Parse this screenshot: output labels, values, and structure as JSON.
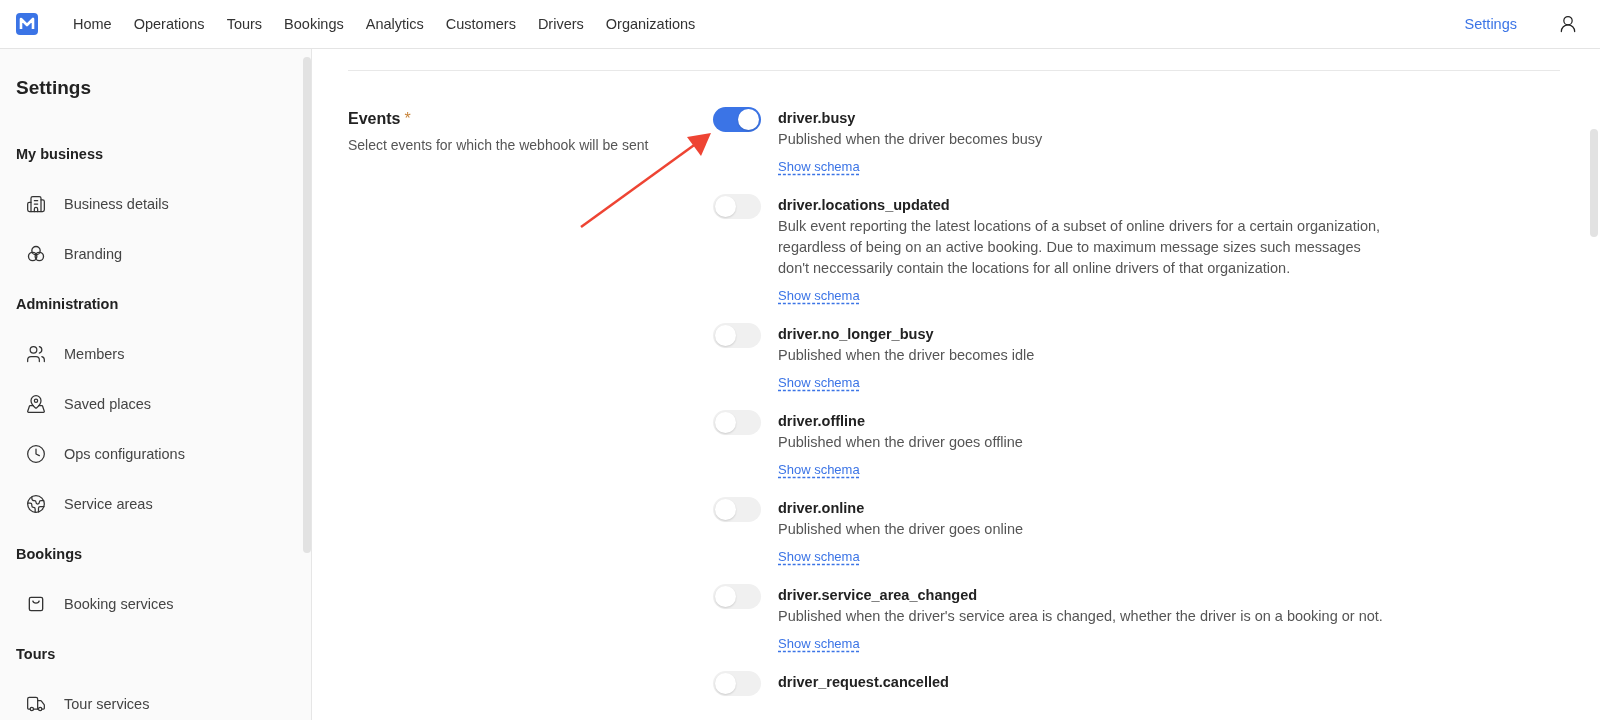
{
  "top_nav": {
    "items": [
      {
        "label": "Home",
        "selected": false
      },
      {
        "label": "Operations",
        "selected": false
      },
      {
        "label": "Tours",
        "selected": false
      },
      {
        "label": "Bookings",
        "selected": false
      },
      {
        "label": "Analytics",
        "selected": false
      },
      {
        "label": "Customers",
        "selected": false
      },
      {
        "label": "Drivers",
        "selected": false
      },
      {
        "label": "Organizations",
        "selected": false
      }
    ],
    "right_link": {
      "label": "Settings",
      "selected": true
    }
  },
  "sidebar": {
    "title": "Settings",
    "sections": [
      {
        "title": "My business",
        "items": [
          {
            "label": "Business details"
          },
          {
            "label": "Branding"
          }
        ]
      },
      {
        "title": "Administration",
        "items": [
          {
            "label": "Members"
          },
          {
            "label": "Saved places"
          },
          {
            "label": "Ops configurations"
          },
          {
            "label": "Service areas"
          }
        ]
      },
      {
        "title": "Bookings",
        "items": [
          {
            "label": "Booking services"
          }
        ]
      },
      {
        "title": "Tours",
        "items": [
          {
            "label": "Tour services"
          }
        ]
      }
    ]
  },
  "events_field": {
    "label": "Events",
    "required_mark": "*",
    "description": "Select events for which the webhook will be sent",
    "events": [
      {
        "name": "driver.busy",
        "description": "Published when the driver becomes busy",
        "link": "Show schema",
        "on": true
      },
      {
        "name": "driver.locations_updated",
        "description": "Bulk event reporting the latest locations of a subset of online drivers for a certain organization, regardless of being on an active booking. Due to maximum message sizes such messages don't neccessarily contain the locations for all online drivers of that organization.",
        "link": "Show schema",
        "on": false
      },
      {
        "name": "driver.no_longer_busy",
        "description": "Published when the driver becomes idle",
        "link": "Show schema",
        "on": false
      },
      {
        "name": "driver.offline",
        "description": "Published when the driver goes offline",
        "link": "Show schema",
        "on": false
      },
      {
        "name": "driver.online",
        "description": "Published when the driver goes online",
        "link": "Show schema",
        "on": false
      },
      {
        "name": "driver.service_area_changed",
        "description": "Published when the driver's service area is changed, whether the driver is on a booking or not.",
        "link": "Show schema",
        "on": false
      },
      {
        "name": "driver_request.cancelled",
        "on": false
      }
    ]
  }
}
